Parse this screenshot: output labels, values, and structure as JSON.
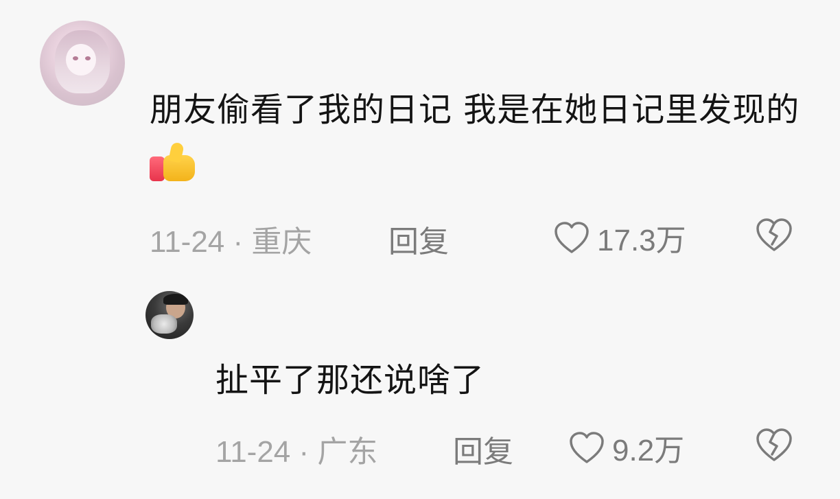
{
  "comments": [
    {
      "text": "朋友偷看了我的日记 我是在她日记里发现的",
      "emoji": "thumbs-up",
      "date_location": "11-24 · 重庆",
      "reply_label": "回复",
      "likes": "17.3万"
    },
    {
      "text": "扯平了那还说啥了",
      "date_location": "11-24 · 广东",
      "reply_label": "回复",
      "likes": "9.2万"
    }
  ],
  "icons": {
    "like": "heart-outline-icon",
    "dislike": "broken-heart-icon"
  },
  "colors": {
    "background": "#f7f7f7",
    "text": "#141414",
    "meta": "#a4a4a4",
    "action": "#7b7b7b"
  }
}
